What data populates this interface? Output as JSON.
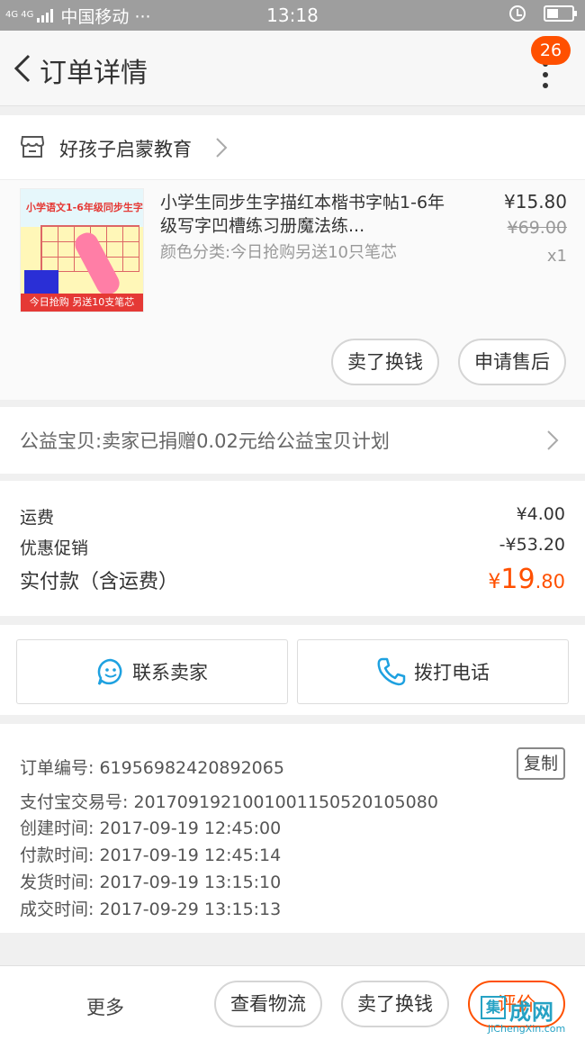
{
  "status_bar": {
    "network": "4G 4G",
    "carrier": "中国移动 ···",
    "time": "13:18"
  },
  "nav": {
    "title": "订单详情",
    "badge": "26"
  },
  "shop": {
    "name": "好孩子启蒙教育"
  },
  "product": {
    "title": "小学生同步生字描红本楷书字帖1-6年级写字凹槽练习册魔法练...",
    "sku": "颜色分类:今日抢购另送10只笔芯",
    "price": "¥15.80",
    "original_price": "¥69.00",
    "quantity": "x1",
    "image_top_text": "小学语文1-6年级同步生字",
    "image_banner": "今日抢购 另送10支笔芯",
    "buttons": {
      "sell": "卖了换钱",
      "after_sale": "申请售后"
    }
  },
  "charity": {
    "text": "公益宝贝:卖家已捐赠0.02元给公益宝贝计划"
  },
  "costs": {
    "shipping_label": "运费",
    "shipping_value": "¥4.00",
    "discount_label": "优惠促销",
    "discount_value": "-¥53.20",
    "total_label": "实付款（含运费）",
    "total_currency": "¥",
    "total_integer": "19",
    "total_decimal": ".80"
  },
  "contact": {
    "seller": "联系卖家",
    "phone": "拨打电话"
  },
  "order_info": {
    "order_number": "订单编号: 61956982420892065",
    "copy": "复制",
    "alipay_number": "支付宝交易号: 2017091921001001150520105080",
    "created": "创建时间: 2017-09-19 12:45:00",
    "paid": "付款时间: 2017-09-19 12:45:14",
    "shipped": "发货时间: 2017-09-19 13:15:10",
    "completed": "成交时间: 2017-09-29 13:15:13"
  },
  "bottom_bar": {
    "more": "更多",
    "track": "查看物流",
    "sell": "卖了换钱",
    "rate": "评价"
  },
  "watermark": {
    "box": "集",
    "text": "成网",
    "url": "JiChengXin.com"
  },
  "colors": {
    "accent": "#ff5000",
    "status_bar": "#9e9e9e",
    "icon_blue": "#1ea1e0",
    "watermark": "#26a2c4"
  }
}
